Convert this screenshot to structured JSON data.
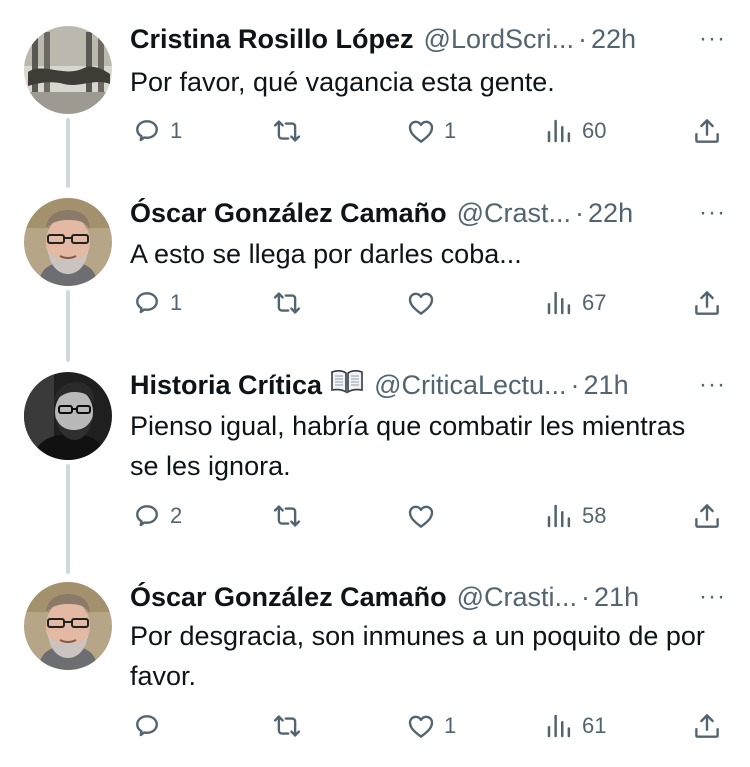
{
  "tweets": [
    {
      "name": "Cristina Rosillo López",
      "handle": "@LordScri...",
      "time": "22h",
      "text": "Por favor, qué vagancia esta gente.",
      "replies": "1",
      "retweets": "",
      "likes": "1",
      "views": "60"
    },
    {
      "name": "Óscar González Camaño",
      "handle": "@Crast...",
      "time": "22h",
      "text": "A esto se llega por darles coba...",
      "replies": "1",
      "retweets": "",
      "likes": "",
      "views": "67"
    },
    {
      "name": "Historia Crítica",
      "emoji": "book-emoji",
      "handle": "@CriticaLectu...",
      "time": "21h",
      "text": "Pienso igual, habría que combatir les mientras se les ignora.",
      "replies": "2",
      "retweets": "",
      "likes": "",
      "views": "58"
    },
    {
      "name": "Óscar González Camaño",
      "handle": "@Crasti...",
      "time": "21h",
      "text": "Por desgracia, son inmunes a un poquito de por favor.",
      "replies": "",
      "retweets": "",
      "likes": "1",
      "views": "61"
    }
  ],
  "separator": "·",
  "more_label": "···",
  "colors": {
    "text": "#0f1419",
    "muted": "#536471",
    "thread_line": "#cfd9de",
    "background": "#ffffff"
  },
  "icons": [
    "reply-icon",
    "retweet-icon",
    "like-icon",
    "views-icon",
    "share-icon",
    "more-icon",
    "book-emoji"
  ]
}
